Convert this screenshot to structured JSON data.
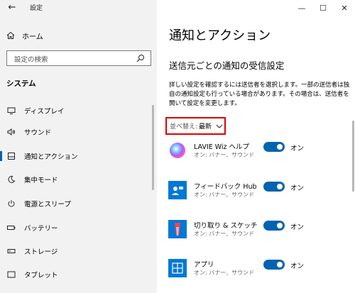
{
  "window": {
    "title": "設定",
    "controls": {
      "minimize": "—",
      "maximize": "☐",
      "close": "✕"
    }
  },
  "sidebar": {
    "home_label": "ホーム",
    "search_placeholder": "設定の検索",
    "section_title": "システム",
    "items": [
      {
        "label": "ディスプレイ",
        "icon": "display-icon"
      },
      {
        "label": "サウンド",
        "icon": "speaker-icon"
      },
      {
        "label": "通知とアクション",
        "icon": "notification-icon",
        "active": true
      },
      {
        "label": "集中モード",
        "icon": "moon-icon"
      },
      {
        "label": "電源とスリープ",
        "icon": "power-icon"
      },
      {
        "label": "バッテリー",
        "icon": "battery-icon"
      },
      {
        "label": "ストレージ",
        "icon": "storage-icon"
      },
      {
        "label": "タブレット",
        "icon": "tablet-icon"
      }
    ]
  },
  "main": {
    "title": "通知とアクション",
    "subtitle": "送信元ごとの通知の受信設定",
    "description": "詳しい設定を確認するには送信者を選択します。一部の送信者は独自の通知設定も行っている場合があります。その場合は、送信者を開いて設定を変更します。",
    "sort": {
      "label": "並べ替え:",
      "value": "最新"
    },
    "apps": [
      {
        "name": "LAVIE Wiz ヘルプ",
        "sub": "オン: バナー、サウンド",
        "toggle_label": "オン",
        "toggle_on": true,
        "icon": "lavie-wiz-icon"
      },
      {
        "name": "フィードバック Hub",
        "sub": "オン: バナー、サウンド",
        "toggle_label": "オン",
        "toggle_on": true,
        "icon": "feedback-hub-icon"
      },
      {
        "name": "切り取り & スケッチ",
        "sub": "オン: バナー、サウンド",
        "toggle_label": "オン",
        "toggle_on": true,
        "icon": "snip-sketch-icon"
      },
      {
        "name": "アプリ",
        "sub": "オン: バナー、サウンド",
        "toggle_label": "オン",
        "toggle_on": true,
        "icon": "apps-icon"
      }
    ]
  },
  "colors": {
    "accent": "#0063b1",
    "sidebar_bg": "#f2f2f2",
    "highlight_border": "#e00000"
  }
}
